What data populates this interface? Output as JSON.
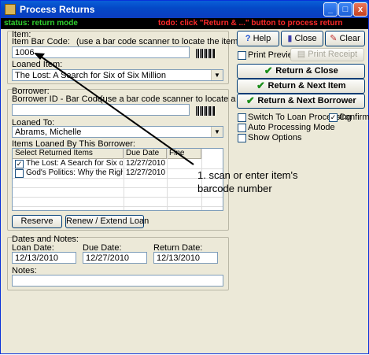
{
  "window": {
    "title": "Process Returns",
    "controls": {
      "minimize": "_",
      "maximize": "□",
      "close": "x"
    }
  },
  "statusbar": {
    "status": "status: return mode",
    "todo": "todo: click \"Return & ...\" button to process return"
  },
  "item": {
    "group_label": "Item:",
    "barcode_label": "Item Bar Code:",
    "barcode_hint": "(use a bar code scanner to locate the item)",
    "barcode_value": "1006",
    "loaned_item_label": "Loaned Item:",
    "loaned_item_value": "The Lost: A Search for Six of Six Million"
  },
  "borrower": {
    "group_label": "Borrower:",
    "id_label": "Borrower ID - Bar Code:",
    "id_hint": "(use a bar code scanner to locate a patron)",
    "id_value": "",
    "loaned_to_label": "Loaned To:",
    "loaned_to_value": "Abrams, Michelle",
    "items_label": "Items Loaned By This Borrower:",
    "table": {
      "headers": [
        "Select Returned Items",
        "Due Date",
        "Fine"
      ],
      "rows": [
        {
          "checked": true,
          "title": "The Lost: A Search for Six of Six Mil...",
          "due": "12/27/2010",
          "fine": ""
        },
        {
          "checked": false,
          "title": "God's Politics: Why the Right Gets I...",
          "due": "12/27/2010",
          "fine": ""
        }
      ]
    },
    "reserve_button": "Reserve",
    "renew_button": "Renew / Extend Loan"
  },
  "dates": {
    "group_label": "Dates and Notes:",
    "loan_label": "Loan Date:",
    "loan_value": "12/13/2010",
    "due_label": "Due Date:",
    "due_value": "12/27/2010",
    "return_label": "Return Date:",
    "return_value": "12/13/2010",
    "notes_label": "Notes:",
    "notes_value": ""
  },
  "right": {
    "help_button": "Help",
    "close_button": "Close",
    "clear_button": "Clear",
    "print_preview_label": "Print Preview",
    "print_receipt_button": "Print Receipt",
    "return_close_button": "Return & Close",
    "return_next_item_button": "Return & Next Item",
    "return_next_borrower_button": "Return & Next Borrower",
    "switch_label": "Switch To Loan Processing",
    "confirm_label": "Confirm",
    "confirm_checked": true,
    "auto_label": "Auto Processing Mode",
    "show_options_label": "Show Options"
  },
  "annotation": {
    "line1": "1. scan or enter item's",
    "line2": "barcode number"
  },
  "colors": {
    "title_bar": "#0449c7",
    "status_text": "#2fd22f",
    "todo_text": "#ff2a2a",
    "check_green": "#1a8d1a"
  },
  "icons": [
    "help-icon",
    "close-book-icon",
    "clear-eraser-icon",
    "print-icon",
    "checkmark-icon",
    "barcode-icon"
  ]
}
